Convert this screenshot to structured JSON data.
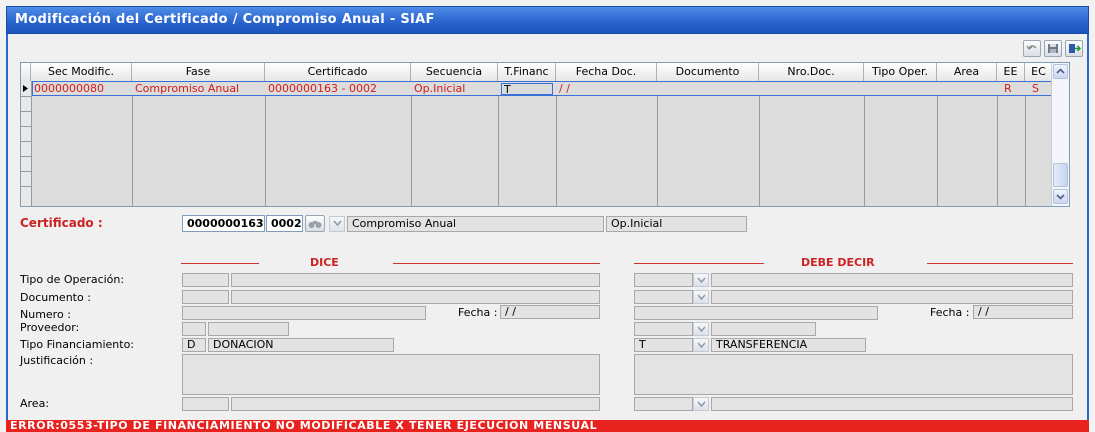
{
  "window": {
    "title": "Modificación del Certificado / Compromiso Anual - SIAF"
  },
  "toolbar": {
    "icons": [
      "undo-icon",
      "save-icon",
      "exit-icon"
    ]
  },
  "grid": {
    "columns": [
      "Sec Modific.",
      "Fase",
      "Certificado",
      "Secuencia",
      "T.Financ",
      "Fecha Doc.",
      "Documento",
      "Nro.Doc.",
      "Tipo Oper.",
      "Area",
      "EE",
      "EC"
    ],
    "rows": [
      [
        "0000000080",
        "Compromiso Anual",
        "0000000163 - 0002",
        "Op.Inicial",
        "T",
        "/ /",
        "",
        "",
        "",
        "",
        "R",
        "S"
      ]
    ],
    "text_color": "#d81a1a"
  },
  "certificado": {
    "label": "Certificado :",
    "numero": "0000000163",
    "secuencia": "0002",
    "fase": "Compromiso Anual",
    "tipo": "Op.Inicial"
  },
  "dice": {
    "title": "DICE",
    "tipo_operacion_label": "Tipo de Operación:",
    "documento_label": "Documento :",
    "numero_label": "Numero :",
    "fecha_label": "Fecha :",
    "fecha_value": "/ /",
    "proveedor_label": "Proveedor:",
    "tipo_fin_label": "Tipo Financiamiento:",
    "tipo_fin_code": "D",
    "tipo_fin_name": "DONACION",
    "justificacion_label": "Justificación :",
    "area_label": "Area:"
  },
  "debe_decir": {
    "title": "DEBE DECIR",
    "fecha_label": "Fecha :",
    "fecha_value": "/ /",
    "tipo_fin_code": "T",
    "tipo_fin_name": "TRANSFERENCIA"
  },
  "status": {
    "message": "ERROR:0553-TIPO DE FINANCIAMIENTO NO MODIFICABLE X TENER EJECUCION MENSUAL",
    "color": "#e8221e"
  },
  "colors": {
    "title_bar": "#2a66cf",
    "accent_red": "#cc2222"
  }
}
